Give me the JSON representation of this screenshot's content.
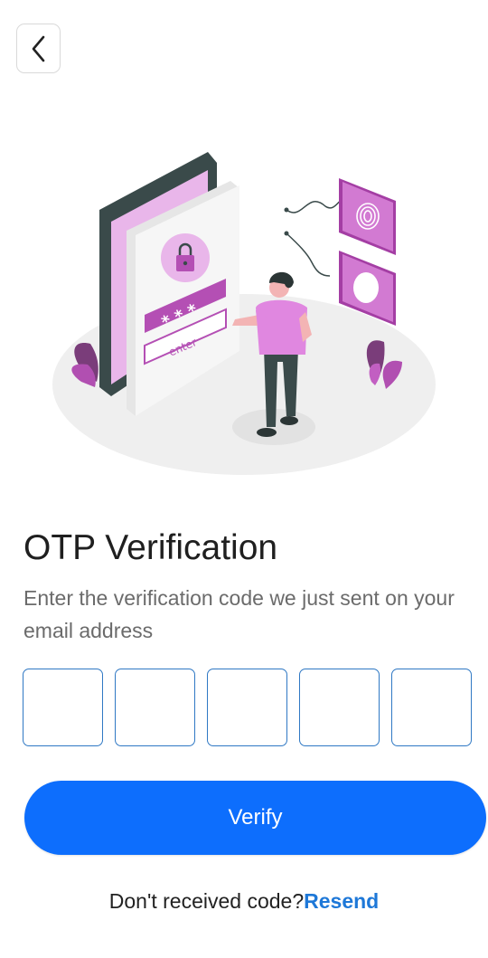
{
  "header": {
    "back_icon": "chevron-left-icon"
  },
  "illustration": {
    "pin_mask": "* * *",
    "enter_label": "enter",
    "accent_color": "#d06bd0"
  },
  "content": {
    "title": "OTP Verification",
    "subtitle": "Enter the verification code we just sent on your email address"
  },
  "otp": {
    "digits": [
      "",
      "",
      "",
      "",
      ""
    ],
    "border_color": "#2f78c4"
  },
  "actions": {
    "verify_label": "Verify",
    "verify_color": "#0d6efd",
    "resend_prompt": "Don't received code?",
    "resend_label": "Resend",
    "resend_color": "#1e78d8"
  }
}
